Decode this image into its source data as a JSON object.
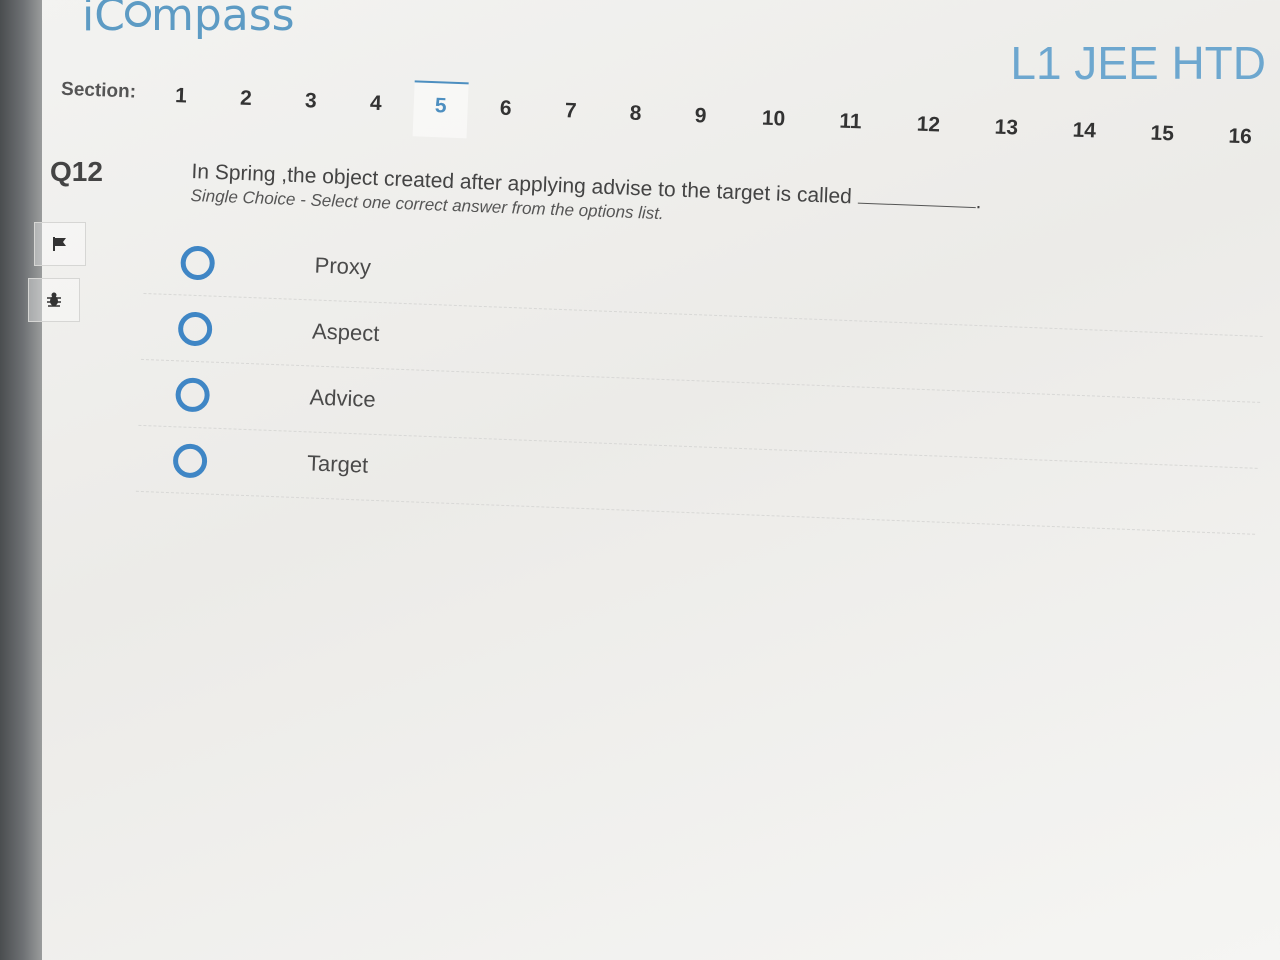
{
  "header": {
    "logo_text": "iCompass",
    "logo_prefix": "iC",
    "logo_suffix": "mpass",
    "course_title": "L1 JEE HTD"
  },
  "sections": {
    "label": "Section:",
    "tabs": [
      "1",
      "2",
      "3",
      "4",
      "5",
      "6",
      "7",
      "8",
      "9",
      "10",
      "11",
      "12",
      "13",
      "14",
      "15",
      "16"
    ],
    "active": "5"
  },
  "question": {
    "number": "Q12",
    "text": "In Spring ,the object created after applying advise to the target is called",
    "trailing_punct": ".",
    "subtitle": "Single Choice - Select one correct answer from the options list."
  },
  "side_tools": {
    "flag_icon": "flag-icon",
    "bug_icon": "bug-icon"
  },
  "options": [
    {
      "label": "Proxy",
      "selected": false
    },
    {
      "label": "Aspect",
      "selected": false
    },
    {
      "label": "Advice",
      "selected": false
    },
    {
      "label": "Target",
      "selected": false
    }
  ],
  "colors": {
    "accent": "#3f86c5",
    "brand": "#5d9bc4"
  }
}
